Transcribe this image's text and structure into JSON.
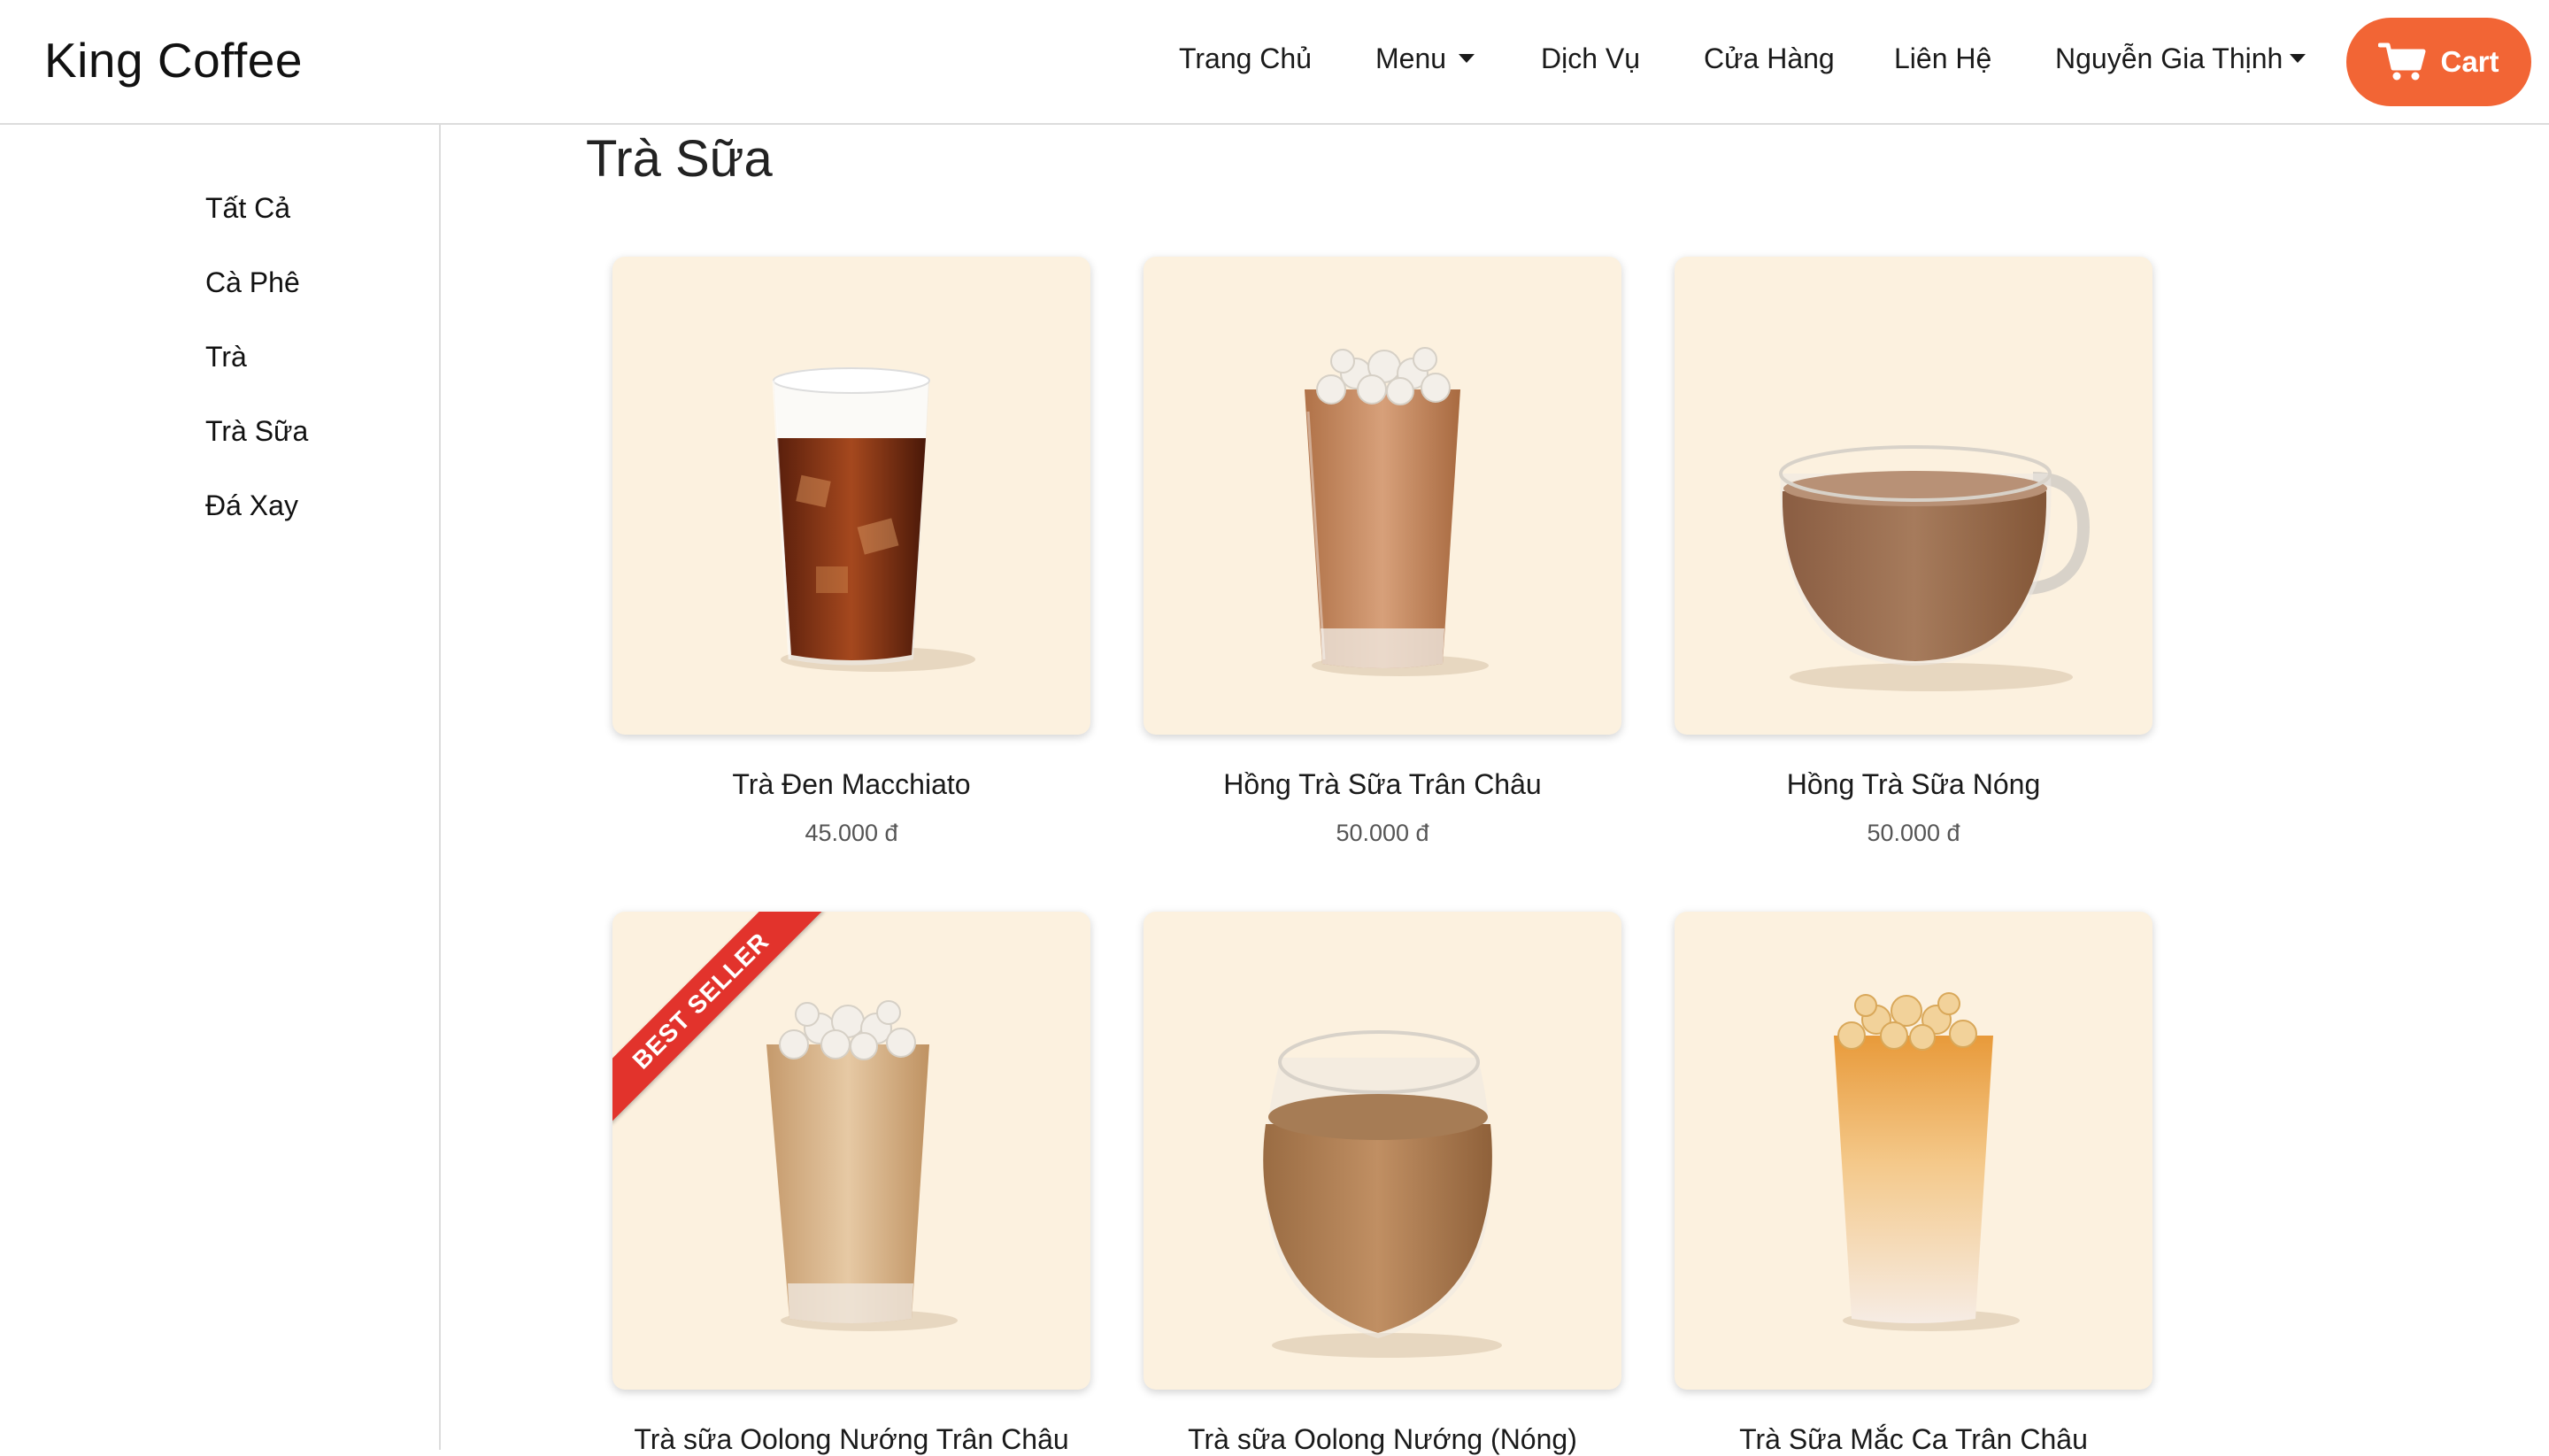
{
  "navbar": {
    "brand": "King Coffee",
    "links": [
      {
        "label": "Trang Chủ"
      },
      {
        "label": "Menu"
      },
      {
        "label": "Dịch Vụ"
      },
      {
        "label": "Cửa Hàng"
      },
      {
        "label": "Liên Hệ"
      },
      {
        "label": "Nguyễn Gia Thịnh"
      }
    ],
    "cart_label": "Cart",
    "accent_color": "#f26535"
  },
  "sidebar": {
    "items": [
      {
        "label": "Tất Cả"
      },
      {
        "label": "Cà Phê"
      },
      {
        "label": "Trà"
      },
      {
        "label": "Trà Sữa"
      },
      {
        "label": "Đá Xay"
      }
    ]
  },
  "main": {
    "title": "Trà Sữa",
    "badge_text": "BEST SELLER",
    "products": [
      {
        "name": "Trà Đen Macchiato",
        "price": "45.000 đ"
      },
      {
        "name": "Hồng Trà Sữa Trân Châu",
        "price": "50.000 đ"
      },
      {
        "name": "Hồng Trà Sữa Nóng",
        "price": "50.000 đ"
      },
      {
        "name": "Trà sữa Oolong Nướng Trân Châu",
        "price": ""
      },
      {
        "name": "Trà sữa Oolong Nướng (Nóng)",
        "price": ""
      },
      {
        "name": "Trà Sữa Mắc Ca Trân Châu",
        "price": ""
      }
    ]
  }
}
